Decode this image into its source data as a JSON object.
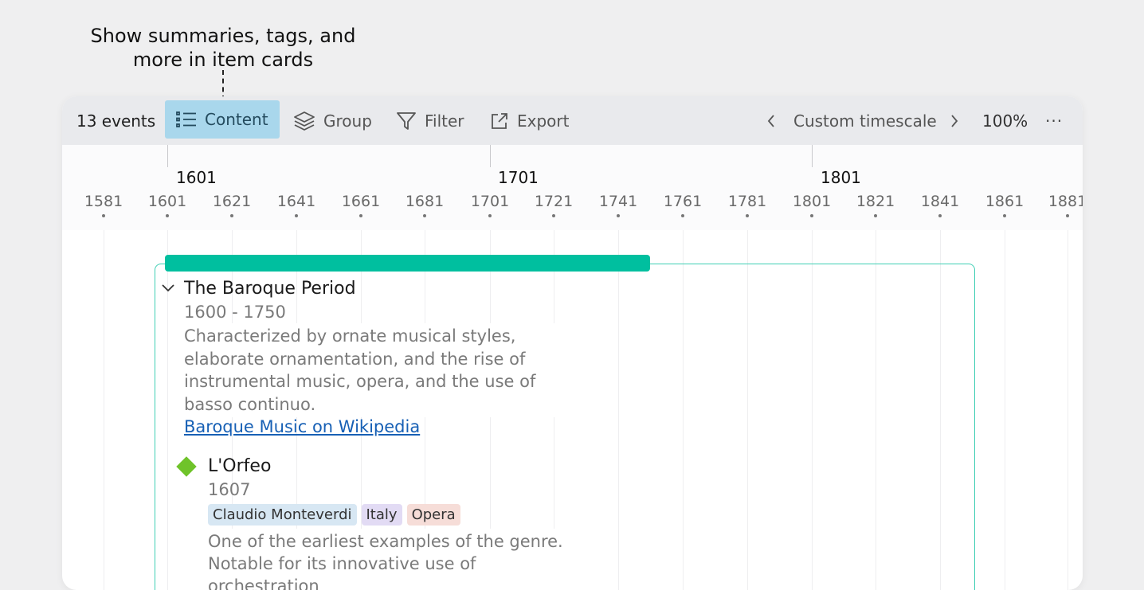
{
  "callout": {
    "line1": "Show summaries, tags, and",
    "line2": "more in item cards"
  },
  "toolbar": {
    "events_count": "13 events",
    "content_label": "Content",
    "group_label": "Group",
    "filter_label": "Filter",
    "export_label": "Export",
    "timescale_label": "Custom timescale",
    "zoom_label": "100%",
    "more_label": "···"
  },
  "axis": {
    "major": [
      "1601",
      "1701",
      "1801"
    ],
    "minor": [
      "1581",
      "1601",
      "1621",
      "1641",
      "1661",
      "1681",
      "1701",
      "1721",
      "1741",
      "1761",
      "1781",
      "1801",
      "1821",
      "1841",
      "1861",
      "1881"
    ]
  },
  "period": {
    "title": "The Baroque Period",
    "dates": "1600 - 1750",
    "description": "Characterized by ornate musical styles, elaborate ornamentation, and the rise of instrumental music, opera, and the use of basso continuo.",
    "link_label": "Baroque Music on Wikipedia",
    "color": "#00bf9f"
  },
  "event": {
    "title": "L'Orfeo",
    "date": "1607",
    "tags": [
      "Claudio Monteverdi",
      "Italy",
      "Opera"
    ],
    "description": "One of the earliest examples of the genre. Notable for its innovative use of orchestration",
    "marker_color": "#6fc32a"
  },
  "icons": {
    "content": "list-icon",
    "group": "layers-icon",
    "filter": "filter-icon",
    "export": "external-link-icon",
    "prev": "chevron-left-icon",
    "next": "chevron-right-icon",
    "collapse": "chevron-down-icon"
  }
}
